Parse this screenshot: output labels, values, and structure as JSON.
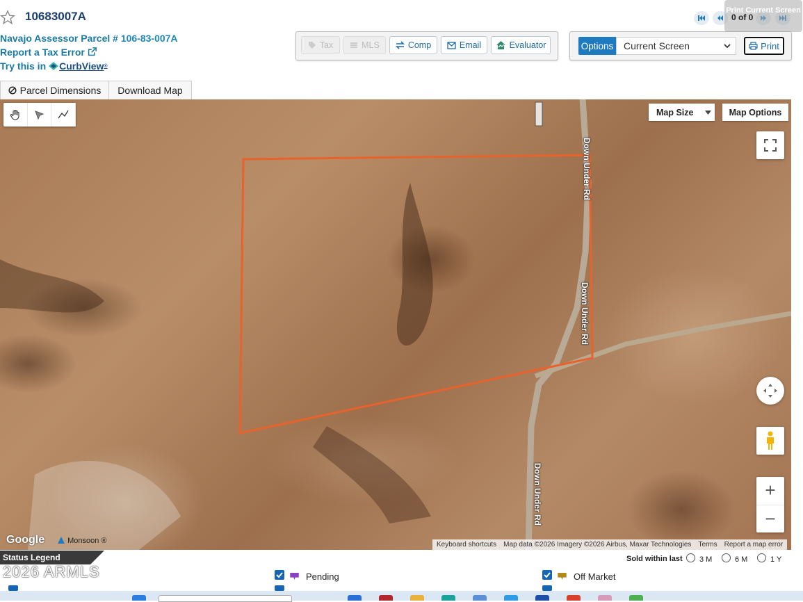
{
  "header": {
    "parcel_id": "10683007A",
    "assessor_label": "Navajo Assessor Parcel #",
    "assessor_number": "106-83-007A",
    "report_error": "Report a Tax Error",
    "try_this_in": "Try this in",
    "curbview": "CurbView"
  },
  "toolbar": {
    "tax": "Tax",
    "mls": "MLS",
    "comp": "Comp",
    "email": "Email",
    "evaluator": "Evaluator"
  },
  "print_options": {
    "options_label": "Options",
    "selected_value": "Current Screen",
    "print_label": "Print"
  },
  "pager": {
    "text": "0 of 0",
    "tooltip": "Print Current Screen"
  },
  "tabs": {
    "parcel_dimensions": "Parcel Dimensions",
    "download_map": "Download Map"
  },
  "map": {
    "map_size": "Map Size",
    "map_options": "Map Options",
    "road_name": "Down Under Rd",
    "google": "Google",
    "monsoon": "Monsoon",
    "attribution": {
      "keyboard": "Keyboard shortcuts",
      "mapdata": "Map data ©2026 Imagery ©2026 Airbus, Maxar Technologies",
      "terms": "Terms",
      "report": "Report a map error"
    },
    "zoom_in": "+",
    "zoom_out": "−"
  },
  "legend": {
    "title": "Status Legend",
    "sold_within": "Sold within last",
    "options": [
      "3 M",
      "6 M",
      "1 Y"
    ],
    "items": [
      {
        "label": "Pending",
        "color": "#8e3fc2"
      },
      {
        "label": "Off Market",
        "color": "#b08a1a"
      }
    ],
    "watermark": "2026 ARMLS"
  },
  "colors": {
    "accent": "#1f7bbf",
    "link": "#1a7aa6",
    "parcel_outline": "#e8622c"
  }
}
